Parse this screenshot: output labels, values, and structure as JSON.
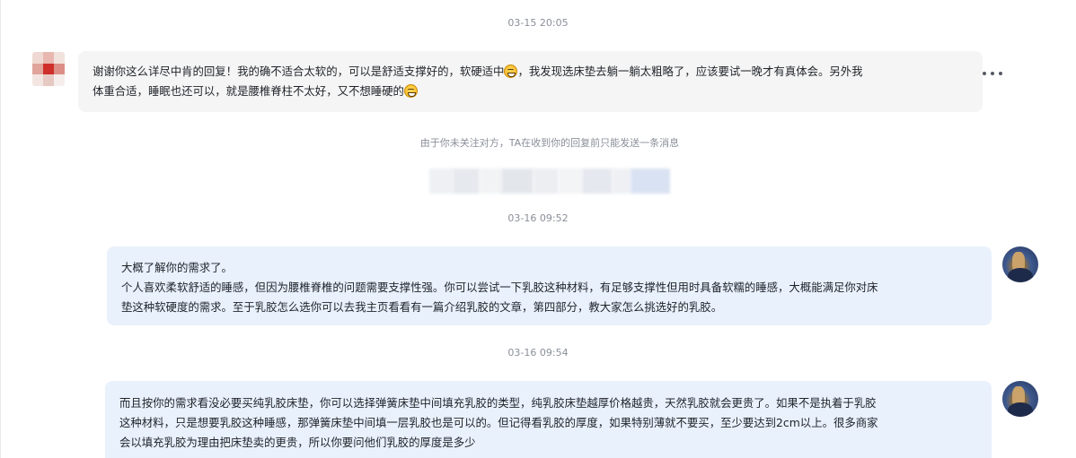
{
  "chat": {
    "timestamps": [
      "03-15 20:05",
      "03-16 09:52",
      "03-16 09:54"
    ],
    "message1": {
      "line1_a": "谢谢你这么详尽中肯的回复！我的确不适合太软的，可以是舒适支撑好的，软硬适中",
      "line1_b": "，我发现选床垫去躺一躺太粗略了，应该要试一晚才有真体会。另外我",
      "line2_a": "体重合适，睡眠也还可以，就是腰椎脊柱不太好，又不想睡硬的",
      "emoji": "grinning-squint-emoji"
    },
    "notice": "由于你未关注对方，TA在收到你的回复前只能发送一条消息",
    "message2": {
      "line1": "大概了解你的需求了。",
      "line2": "个人喜欢柔软舒适的睡感，但因为腰椎脊椎的问题需要支撑性强。你可以尝试一下乳胶这种材料，有足够支撑性但用时具备软糯的睡感，大概能满足你对床",
      "line3": "垫这种软硬度的需求。至于乳胶怎么选你可以去我主页看看有一篇介绍乳胶的文章，第四部分，教大家怎么挑选好的乳胶。"
    },
    "message3": {
      "line1": "而且按你的需求看没必要买纯乳胶床垫，你可以选择弹簧床垫中间填充乳胶的类型，纯乳胶床垫越厚价格越贵，天然乳胶就会更贵了。如果不是执着于乳胶",
      "line2": "这种材料，只是想要乳胶这种睡感，那弹簧床垫中间填一层乳胶也是可以的。但记得看乳胶的厚度，如果特别薄就不要买，至少要达到2cm以上。很多商家",
      "line3": "会以填充乳胶为理由把床垫卖的更贵，所以你要问他们乳胶的厚度是多少"
    }
  },
  "colors": {
    "incoming_bubble": "#f5f5f5",
    "outgoing_bubble": "#e9f1fd",
    "meta_text": "#8a8f99"
  },
  "icons": {
    "more": "more-dots-icon"
  }
}
